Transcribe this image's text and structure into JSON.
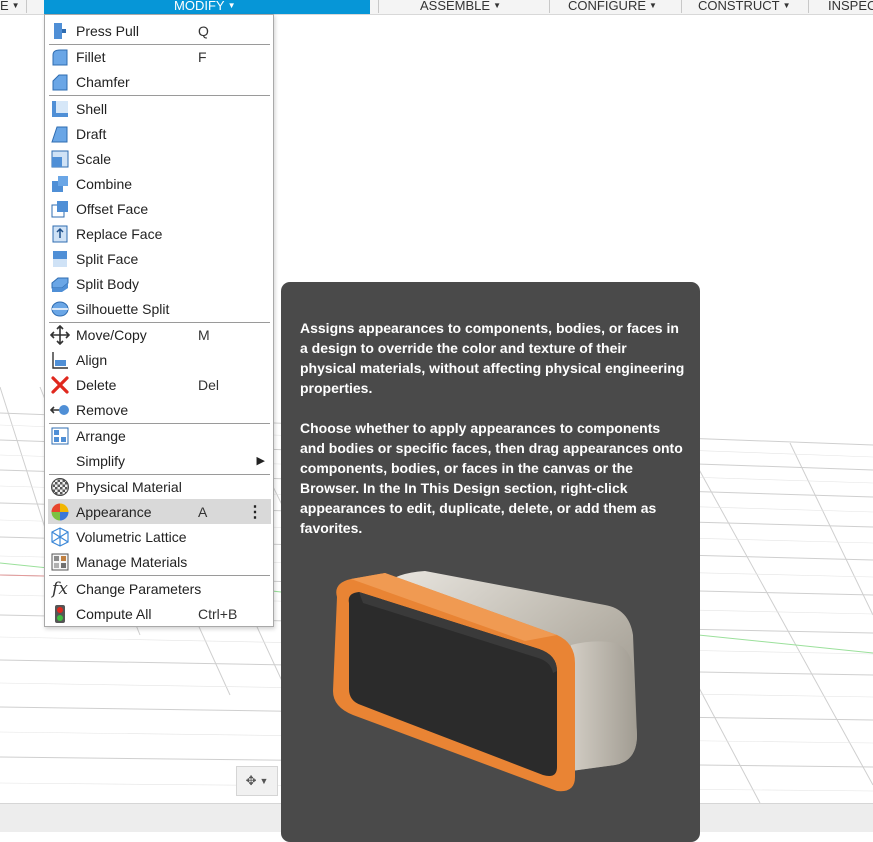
{
  "toolbar": {
    "left_fragment": "E",
    "modify": "MODIFY",
    "assemble": "ASSEMBLE",
    "configure": "CONFIGURE",
    "construct": "CONSTRUCT",
    "inspect_fragment": "INSPEC",
    "accent": "#0696d7"
  },
  "menu": {
    "items": [
      {
        "label": "Press Pull",
        "shortcut": "Q",
        "icon": "press-pull-icon"
      },
      {
        "label": "Fillet",
        "shortcut": "F",
        "icon": "fillet-icon"
      },
      {
        "label": "Chamfer",
        "shortcut": "",
        "icon": "chamfer-icon"
      },
      {
        "label": "Shell",
        "shortcut": "",
        "icon": "shell-icon"
      },
      {
        "label": "Draft",
        "shortcut": "",
        "icon": "draft-icon"
      },
      {
        "label": "Scale",
        "shortcut": "",
        "icon": "scale-icon"
      },
      {
        "label": "Combine",
        "shortcut": "",
        "icon": "combine-icon"
      },
      {
        "label": "Offset Face",
        "shortcut": "",
        "icon": "offset-face-icon"
      },
      {
        "label": "Replace Face",
        "shortcut": "",
        "icon": "replace-face-icon"
      },
      {
        "label": "Split Face",
        "shortcut": "",
        "icon": "split-face-icon"
      },
      {
        "label": "Split Body",
        "shortcut": "",
        "icon": "split-body-icon"
      },
      {
        "label": "Silhouette Split",
        "shortcut": "",
        "icon": "silhouette-split-icon"
      },
      {
        "label": "Move/Copy",
        "shortcut": "M",
        "icon": "move-copy-icon"
      },
      {
        "label": "Align",
        "shortcut": "",
        "icon": "align-icon"
      },
      {
        "label": "Delete",
        "shortcut": "Del",
        "icon": "delete-icon"
      },
      {
        "label": "Remove",
        "shortcut": "",
        "icon": "remove-icon"
      },
      {
        "label": "Arrange",
        "shortcut": "",
        "icon": "arrange-icon"
      },
      {
        "label": "Simplify",
        "shortcut": "",
        "icon": ""
      },
      {
        "label": "Physical Material",
        "shortcut": "",
        "icon": "physical-material-icon"
      },
      {
        "label": "Appearance",
        "shortcut": "A",
        "icon": "appearance-icon"
      },
      {
        "label": "Volumetric Lattice",
        "shortcut": "",
        "icon": "volumetric-lattice-icon"
      },
      {
        "label": "Manage Materials",
        "shortcut": "",
        "icon": "manage-materials-icon"
      },
      {
        "label": "Change Parameters",
        "shortcut": "",
        "icon": "change-parameters-icon"
      },
      {
        "label": "Compute All",
        "shortcut": "Ctrl+B",
        "icon": "compute-all-icon"
      }
    ]
  },
  "tooltip": {
    "paragraph1": "Assigns appearances to components, bodies, or faces in a design to override the color and texture of their physical materials, without affecting physical engineering properties.",
    "paragraph2": "Choose whether to apply appearances to components and bodies or specific faces, then drag appearances onto components, bodies, or faces in the canvas or the Browser. In the In This Design section, right-click appearances to edit, duplicate, delete, or add them as favorites."
  }
}
